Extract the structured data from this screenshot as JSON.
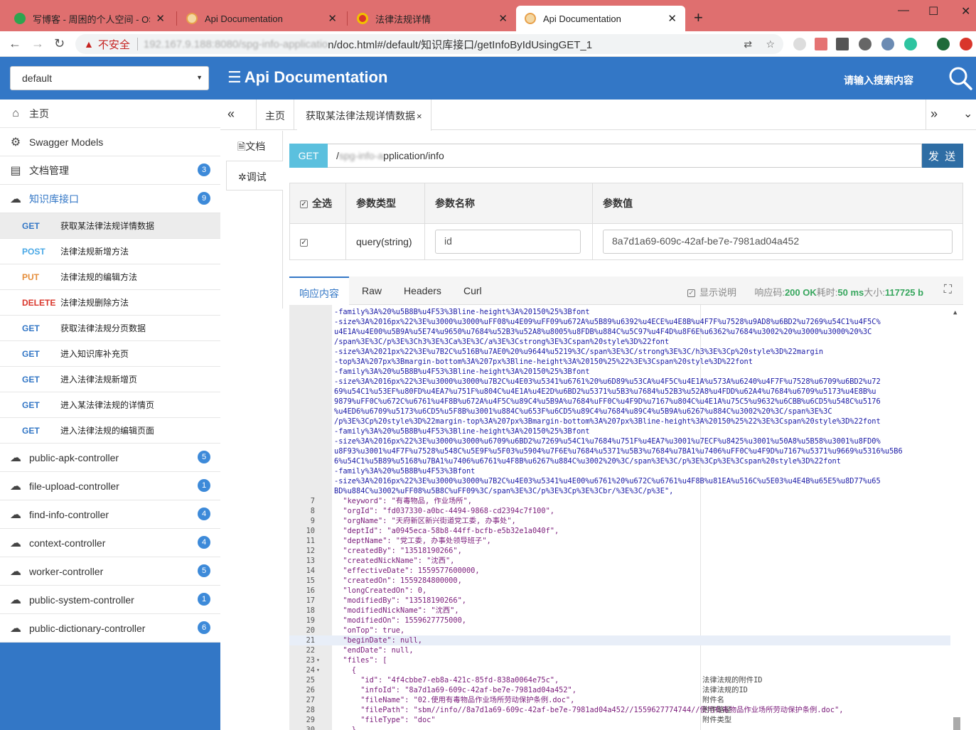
{
  "browser": {
    "tabs": [
      {
        "title": "写博客 - 周困的个人空间 - OSCh",
        "favicon_color": "#2ea44f"
      },
      {
        "title": "Api Documentation",
        "favicon_color": "#e8a04a"
      },
      {
        "title": "法律法规详情",
        "favicon_color": "#d9362b"
      },
      {
        "title": "Api Documentation",
        "favicon_color": "#e8a04a"
      }
    ],
    "insecure_label": "不安全",
    "url_host": "192.167.9.188:8080/spg-info-applicatio",
    "url_path": "n/doc.html#/default/知识库接口/getInfoByIdUsingGET_1"
  },
  "header": {
    "group_select": "default",
    "title": "Api Documentation",
    "search_placeholder": "请输入搜索内容"
  },
  "sidebar": {
    "items": [
      {
        "label": "主页",
        "icon": "home-icon"
      },
      {
        "label": "Swagger Models",
        "icon": "models-icon"
      },
      {
        "label": "文档管理",
        "icon": "doc-manage-icon",
        "badge": "3"
      },
      {
        "label": "知识库接口",
        "icon": "cloud-icon",
        "badge": "9"
      }
    ],
    "apis": [
      {
        "method": "GET",
        "label": "获取某法律法规详情数据"
      },
      {
        "method": "POST",
        "label": "法律法规新增方法"
      },
      {
        "method": "PUT",
        "label": "法律法规的编辑方法"
      },
      {
        "method": "DELETE",
        "label": "法律法规删除方法"
      },
      {
        "method": "GET",
        "label": "获取法律法规分页数据"
      },
      {
        "method": "GET",
        "label": "进入知识库补充页"
      },
      {
        "method": "GET",
        "label": "进入法律法规新增页"
      },
      {
        "method": "GET",
        "label": "进入某法律法规的详情页"
      },
      {
        "method": "GET",
        "label": "进入法律法规的编辑页面"
      }
    ],
    "controllers": [
      {
        "label": "public-apk-controller",
        "badge": "5"
      },
      {
        "label": "file-upload-controller",
        "badge": "1"
      },
      {
        "label": "find-info-controller",
        "badge": "4"
      },
      {
        "label": "context-controller",
        "badge": "4"
      },
      {
        "label": "worker-controller",
        "badge": "5"
      },
      {
        "label": "public-system-controller",
        "badge": "1"
      },
      {
        "label": "public-dictionary-controller",
        "badge": "6"
      }
    ]
  },
  "content": {
    "home_tab": "主页",
    "current_tab": "获取某法律法规详情数据",
    "doc_tab": "文档",
    "debug_tab": "调试",
    "method": "GET",
    "url_prefix": "/",
    "url_blurred": "spg-info-a",
    "url_suffix": "pplication/info",
    "send_label": "发 送",
    "params": {
      "headers": {
        "select_all": "全选",
        "type": "参数类型",
        "name": "参数名称",
        "value": "参数值"
      },
      "row": {
        "type": "query(string)",
        "name": "id",
        "value": "8a7d1a69-609c-42af-be7e-7981ad04a452"
      }
    },
    "response": {
      "tabs": [
        "响应内容",
        "Raw",
        "Headers",
        "Curl"
      ],
      "show_desc": "显示说明",
      "code_label": "响应码:",
      "code_value": "200 OK",
      "time_label": "耗时:",
      "time_value": "50 ms",
      "size_label": "大小:",
      "size_value": "117725 b"
    },
    "code_lines": [
      {
        "n": "",
        "t": "-family%3A%20%u5B8B%u4F53%3Bline-height%3A%20150%25%3Bfont"
      },
      {
        "n": "",
        "t": "-size%3A%2016px%22%3E%u3000%u3000%uFF08%u4E09%uFF09%u672A%u5B89%u6392%u4ECE%u4E8B%u4F7F%u7528%u9AD8%u6BD2%u7269%u54C1%u4F5C%"
      },
      {
        "n": "",
        "t": "u4E1A%u4E00%u5B9A%u5E74%u9650%u7684%u52B3%u52A8%u8005%u8FDB%u884C%u5C97%u4F4D%u8F6E%u6362%u7684%u3002%20%u3000%u3000%20%3C"
      },
      {
        "n": "",
        "t": "/span%3E%3C/p%3E%3Ch3%3E%3Ca%3E%3C/a%3E%3Cstrong%3E%3Cspan%20style%3D%22font"
      },
      {
        "n": "",
        "t": "-size%3A%2021px%22%3E%u7B2C%u516B%u7AE0%20%u9644%u5219%3C/span%3E%3C/strong%3E%3C/h3%3E%3Cp%20style%3D%22margin"
      },
      {
        "n": "",
        "t": "-top%3A%207px%3Bmargin-bottom%3A%207px%3Bline-height%3A%20150%25%22%3E%3Cspan%20style%3D%22font"
      },
      {
        "n": "",
        "t": "-family%3A%20%u5B8B%u4F53%3Bline-height%3A%20150%25%3Bfont"
      },
      {
        "n": "",
        "t": "-size%3A%2016px%22%3E%u3000%u3000%u7B2C%u4E03%u5341%u6761%20%u6D89%u53CA%u4F5C%u4E1A%u573A%u6240%u4F7F%u7528%u6709%u6BD2%u72"
      },
      {
        "n": "",
        "t": "69%u54C1%u53EF%u80FD%u4EA7%u751F%u804C%u4E1A%u4E2D%u6BD2%u5371%u5B3%u7684%u52B3%u52A8%u4FDD%u62A4%u7684%u6709%u5173%u4E8B%u"
      },
      {
        "n": "",
        "t": "9879%uFF0C%u672C%u6761%u4F8B%u672A%u4F5C%u89C4%u5B9A%u7684%uFF0C%u4F9D%u7167%u804C%u4E1A%u75C5%u9632%u6CBB%u6CD5%u548C%u5176"
      },
      {
        "n": "",
        "t": "%u4ED6%u6709%u5173%u6CD5%u5F8B%u3001%u884C%u653F%u6CD5%u89C4%u7684%u89C4%u5B9A%u6267%u884C%u3002%20%3C/span%3E%3C"
      },
      {
        "n": "",
        "t": "/p%3E%3Cp%20style%3D%22margin-top%3A%207px%3Bmargin-bottom%3A%207px%3Bline-height%3A%20150%25%22%3E%3Cspan%20style%3D%22font"
      },
      {
        "n": "",
        "t": "-family%3A%20%u5B8B%u4F53%3Bline-height%3A%20150%25%3Bfont"
      },
      {
        "n": "",
        "t": "-size%3A%2016px%22%3E%u3000%u3000%u6709%u6BD2%u7269%u54C1%u7684%u751F%u4EA7%u3001%u7ECF%u8425%u3001%u50A8%u5B58%u3001%u8FD0%"
      },
      {
        "n": "",
        "t": "u8F93%u3001%u4F7F%u7528%u548C%u5E9F%u5F03%u5904%u7F6E%u7684%u5371%u5B3%u7684%u7BA1%u7406%uFF0C%u4F9D%u7167%u5371%u9669%u5316%u5B6"
      },
      {
        "n": "",
        "t": "6%u54C1%u5B89%u5168%u7BA1%u7406%u6761%u4F8B%u6267%u884C%u3002%20%3C/span%3E%3C/p%3E%3Cp%3E%3Cspan%20style%3D%22font"
      },
      {
        "n": "",
        "t": "-family%3A%20%u5B8B%u4F53%3Bfont"
      },
      {
        "n": "",
        "t": "-size%3A%2016px%22%3E%u3000%u3000%u7B2C%u4E03%u5341%u4E00%u6761%20%u672C%u6761%u4F8B%u81EA%u516C%u5E03%u4E4B%u65E5%u8D77%u65"
      },
      {
        "n": "",
        "t": "BD%u884C%u3002%uFF08%u5B8C%uFF09%3C/span%3E%3C/p%3E%3Cp%3E%3Cbr/%3E%3C/p%3E\","
      },
      {
        "n": "7",
        "t": "  \"keyword\": \"有毒物品, 作业场所\","
      },
      {
        "n": "8",
        "t": "  \"orgId\": \"fd037330-a0bc-4494-9868-cd2394c7f100\","
      },
      {
        "n": "9",
        "t": "  \"orgName\": \"天府新区新兴街道党工委, 办事处\","
      },
      {
        "n": "10",
        "t": "  \"deptId\": \"a0945eca-58b8-44ff-bcfb-e5b32e1a040f\","
      },
      {
        "n": "11",
        "t": "  \"deptName\": \"党工委, 办事处领导班子\","
      },
      {
        "n": "12",
        "t": "  \"createdBy\": \"13518190266\","
      },
      {
        "n": "13",
        "t": "  \"createdNickName\": \"沈西\","
      },
      {
        "n": "14",
        "t": "  \"effectiveDate\": 1559577600000,"
      },
      {
        "n": "15",
        "t": "  \"createdOn\": 1559284800000,"
      },
      {
        "n": "16",
        "t": "  \"longCreatedOn\": 0,"
      },
      {
        "n": "17",
        "t": "  \"modifiedBy\": \"13518190266\","
      },
      {
        "n": "18",
        "t": "  \"modifiedNickName\": \"沈西\","
      },
      {
        "n": "19",
        "t": "  \"modifiedOn\": 1559627775000,"
      },
      {
        "n": "20",
        "t": "  \"onTop\": true,"
      },
      {
        "n": "21",
        "t": "  \"beginDate\": null,"
      },
      {
        "n": "22",
        "t": "  \"endDate\": null,"
      },
      {
        "n": "23",
        "t": "  \"files\": ["
      },
      {
        "n": "24",
        "t": "    {"
      },
      {
        "n": "25",
        "t": "      \"id\": \"4f4cbbe7-eb8a-421c-85fd-838a0064e75c\","
      },
      {
        "n": "26",
        "t": "      \"infoId\": \"8a7d1a69-609c-42af-be7e-7981ad04a452\","
      },
      {
        "n": "27",
        "t": "      \"fileName\": \"02.使用有毒物品作业场所劳动保护条例.doc\","
      },
      {
        "n": "28",
        "t": "      \"filePath\": \"sbm//info//8a7d1a69-609c-42af-be7e-7981ad04a452//1559627774744//使用有毒物品作业场所劳动保护条例.doc\","
      },
      {
        "n": "29",
        "t": "      \"fileType\": \"doc\""
      },
      {
        "n": "30",
        "t": "    }"
      }
    ],
    "annotations": [
      {
        "line": 25,
        "text": "法律法规的附件ID"
      },
      {
        "line": 26,
        "text": "法律法规的ID"
      },
      {
        "line": 27,
        "text": "附件名"
      },
      {
        "line": 28,
        "text": "附件路径"
      },
      {
        "line": 29,
        "text": "附件类型"
      }
    ]
  }
}
